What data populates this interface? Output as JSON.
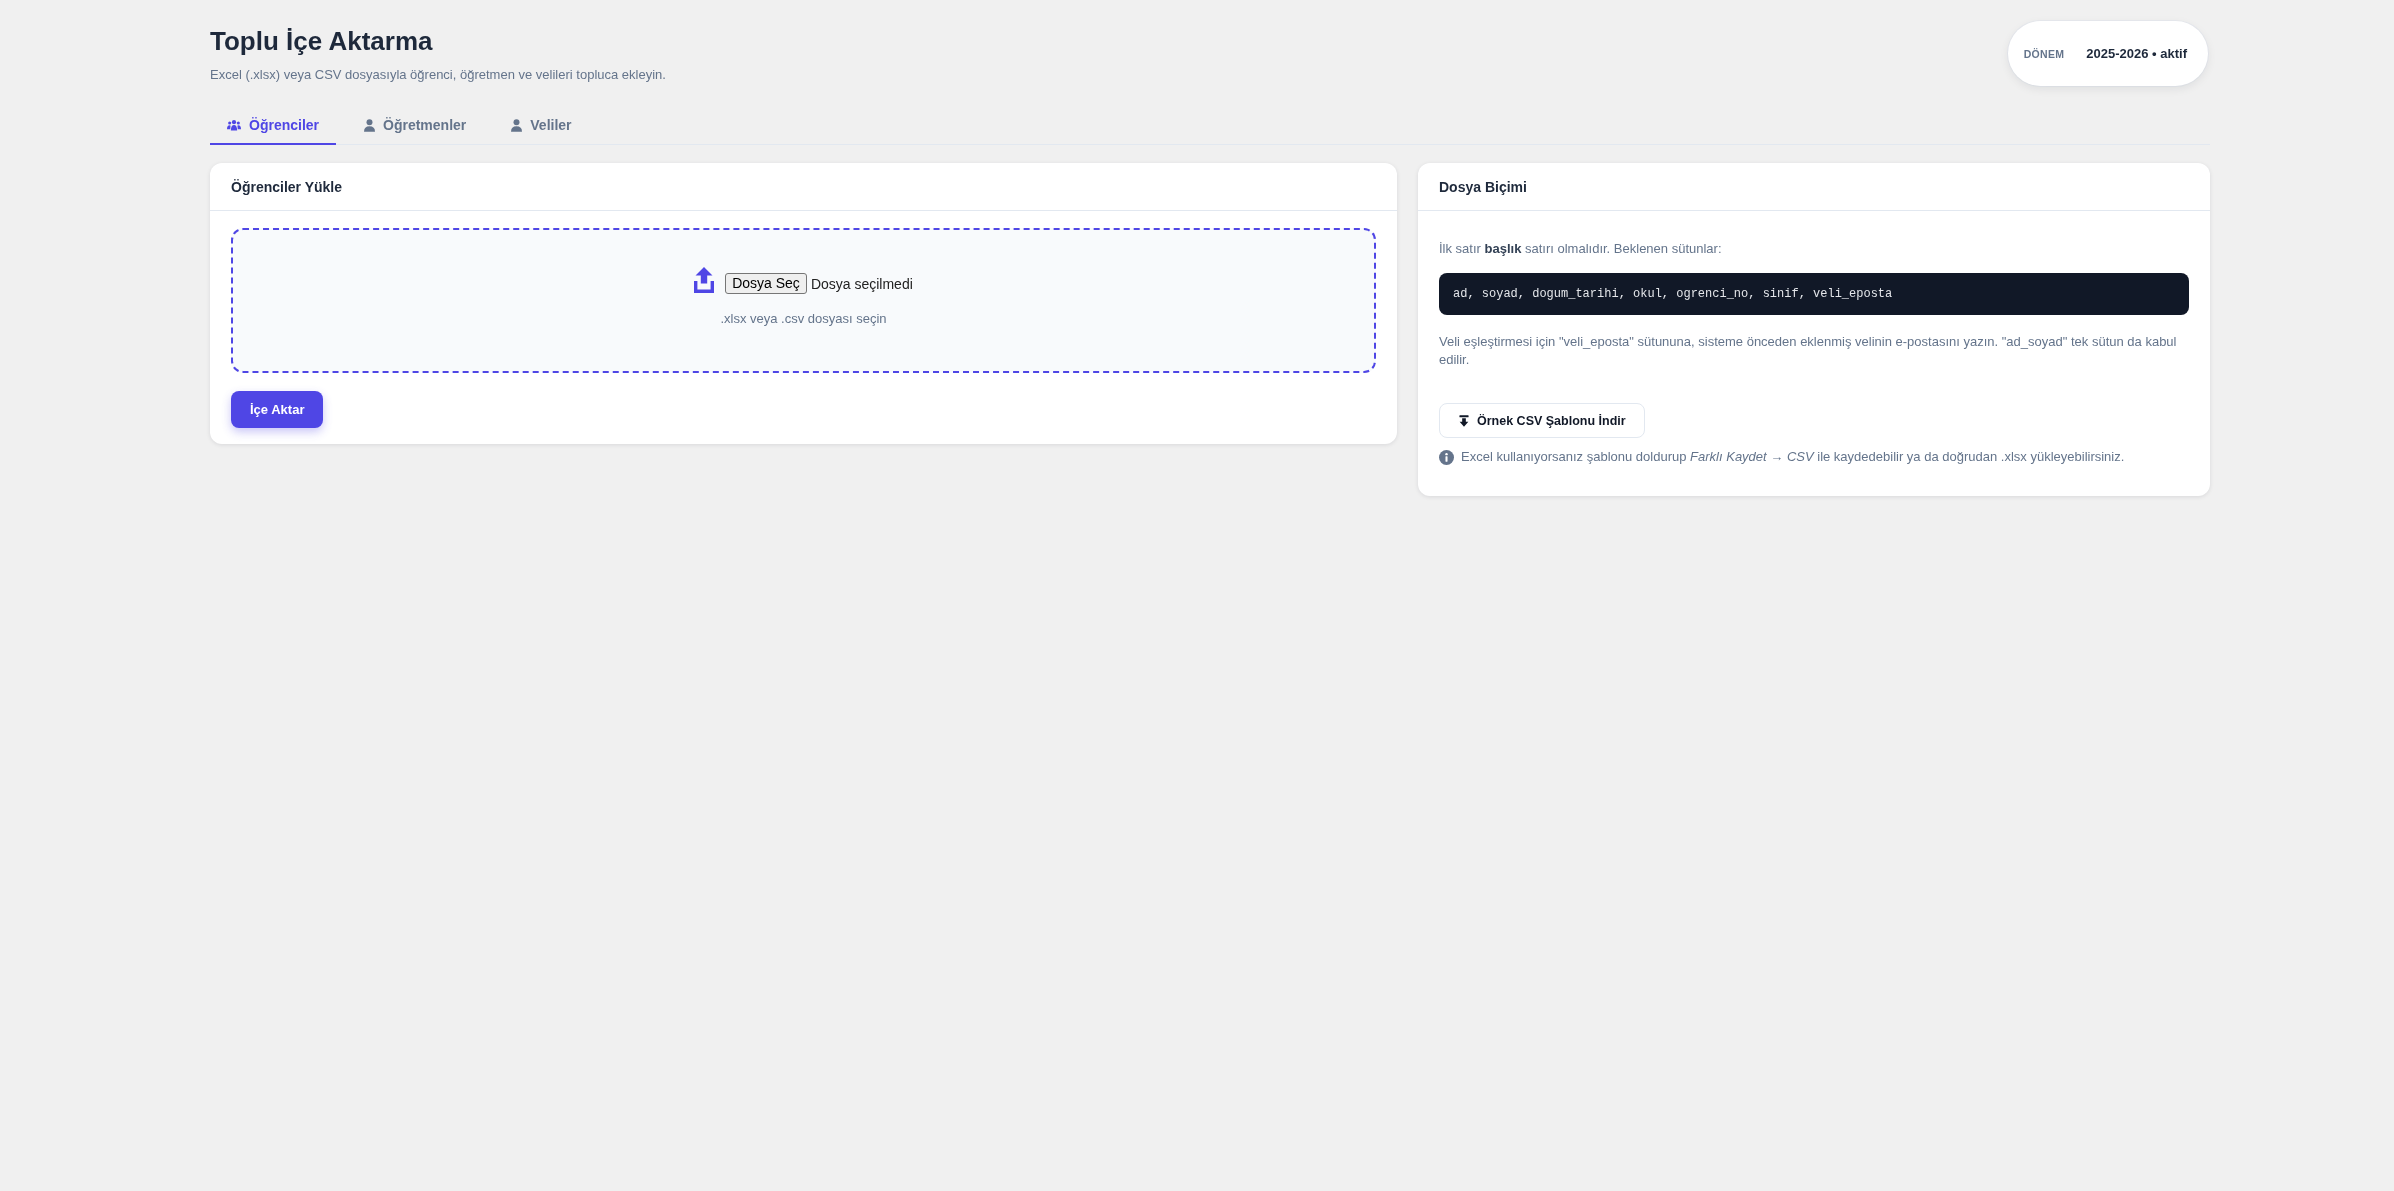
{
  "header": {
    "title": "Toplu İçe Aktarma",
    "subtitle": "Excel (.xlsx) veya CSV dosyasıyla öğrenci, öğretmen ve velileri topluca ekleyin."
  },
  "term_badge": {
    "label": "DÖNEM",
    "value": "2025-2026 • aktif"
  },
  "tabs": [
    {
      "label": "Öğrenciler",
      "selected": true
    },
    {
      "label": "Öğretmenler",
      "selected": false
    },
    {
      "label": "Veliler",
      "selected": false
    }
  ],
  "upload_card": {
    "title": "Öğrenciler Yükle",
    "file_button": "Dosya Seç",
    "file_status": "Dosya seçilmedi",
    "hint": ".xlsx veya .csv dosyası seçin",
    "import_button": "İçe Aktar"
  },
  "format_card": {
    "title": "Dosya Biçimi",
    "intro": "İlk satır **başlık** satırı olmalıdır. Beklenen sütunlar:",
    "columns_code": "ad, soyad, dogum_tarihi, okul, ogrenci_no, sinif, veli_eposta",
    "note": "Veli eşleştirmesi için \"veli_eposta\" sütununa, sisteme önceden eklenmiş velinin e-postasını yazın. \"ad_soyad\" tek sütun da kabul edilir.",
    "download_button": "Örnek CSV Şablonu İndir",
    "tip": "Excel kullanıyorsanız şablonu doldurup *Farklı Kaydet → CSV* ile kaydedebilir ya da doğrudan .xlsx yükleyebilirsiniz."
  }
}
